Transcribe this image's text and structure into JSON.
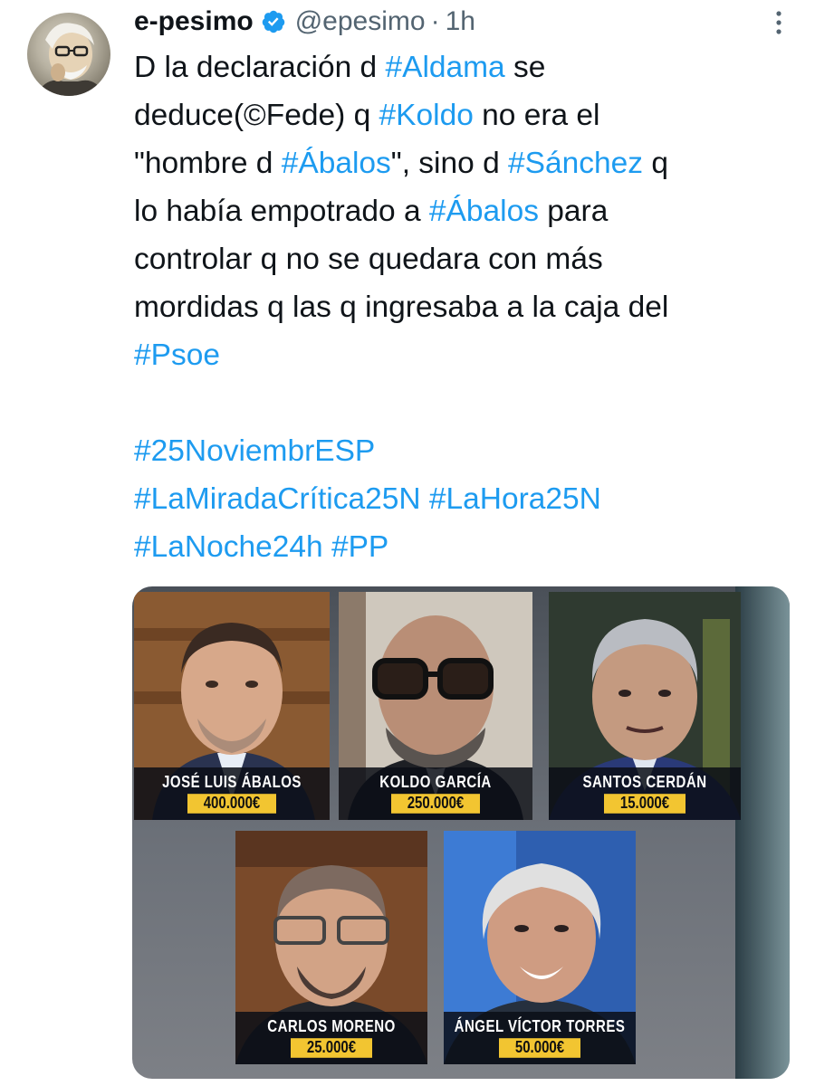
{
  "post": {
    "author_name": "e-pesimo",
    "handle": "@epesimo",
    "separator": "·",
    "time": "1h",
    "text_segments": [
      {
        "text": "D la declaración d ",
        "type": "text"
      },
      {
        "text": "#Aldama",
        "type": "hashtag"
      },
      {
        "text": " se\ndeduce(©Fede) q ",
        "type": "text"
      },
      {
        "text": "#Koldo",
        "type": "hashtag"
      },
      {
        "text": " no era el\n\"hombre d ",
        "type": "text"
      },
      {
        "text": "#Ábalos",
        "type": "hashtag"
      },
      {
        "text": "\", sino d ",
        "type": "text"
      },
      {
        "text": "#Sánchez",
        "type": "hashtag"
      },
      {
        "text": " q\nlo había empotrado a ",
        "type": "text"
      },
      {
        "text": "#Ábalos",
        "type": "hashtag"
      },
      {
        "text": " para\ncontrolar q no se quedara con más\nmordidas q las q ingresaba a la caja del\n",
        "type": "text"
      },
      {
        "text": "#Psoe",
        "type": "hashtag"
      },
      {
        "text": "\n\n",
        "type": "text"
      },
      {
        "text": "#25NoviembrESP",
        "type": "hashtag"
      },
      {
        "text": "\n",
        "type": "text"
      },
      {
        "text": "#LaMiradaCrítica25N",
        "type": "hashtag"
      },
      {
        "text": " ",
        "type": "text"
      },
      {
        "text": "#LaHora25N",
        "type": "hashtag"
      },
      {
        "text": "\n",
        "type": "text"
      },
      {
        "text": "#LaNoche24h",
        "type": "hashtag"
      },
      {
        "text": " ",
        "type": "text"
      },
      {
        "text": "#PP",
        "type": "hashtag"
      }
    ]
  },
  "media": {
    "cards": [
      {
        "name": "JOSÉ LUIS ÁBALOS",
        "amount": "400.000€"
      },
      {
        "name": "KOLDO GARCÍA",
        "amount": "250.000€"
      },
      {
        "name": "SANTOS CERDÁN",
        "amount": "15.000€"
      },
      {
        "name": "CARLOS MORENO",
        "amount": "25.000€"
      },
      {
        "name": "ÁNGEL VÍCTOR TORRES",
        "amount": "50.000€"
      }
    ]
  },
  "colors": {
    "hashtag": "#1d9bf0",
    "text": "#0f1419",
    "secondary": "#536471",
    "amount_bg": "#f2c531"
  },
  "icons": [
    "verified-badge-icon",
    "more-options-icon"
  ]
}
